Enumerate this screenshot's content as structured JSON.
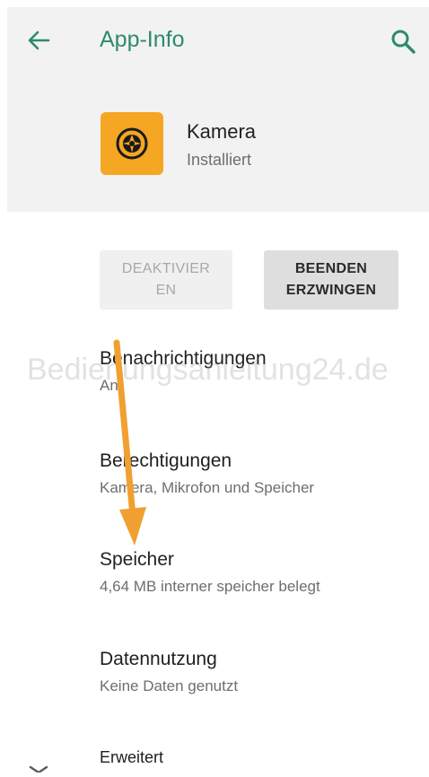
{
  "header": {
    "title": "App-Info",
    "back_icon": "arrow-back-icon",
    "search_icon": "search-icon",
    "accent_color": "#2d8a6f",
    "background": "#f2f2f2"
  },
  "app": {
    "name": "Kamera",
    "status": "Installiert",
    "icon": "camera-aperture-icon",
    "icon_color": "#f5a623"
  },
  "buttons": {
    "deactivate_line1": "DEAKTIVIER",
    "deactivate_line2": "EN",
    "force_stop_line1": "BEENDEN",
    "force_stop_line2": "ERZWINGEN"
  },
  "settings": [
    {
      "title": "Benachrichtigungen",
      "subtitle": "An"
    },
    {
      "title": "Berechtigungen",
      "subtitle": "Kamera, Mikrofon und Speicher"
    },
    {
      "title": "Speicher",
      "subtitle": "4,64 MB interner speicher belegt"
    },
    {
      "title": "Datennutzung",
      "subtitle": "Keine Daten genutzt"
    },
    {
      "title": "Erweitert"
    }
  ],
  "watermark": "Bedienungsanleitung24.de",
  "annotation": {
    "arrow_color": "#f0a030"
  }
}
